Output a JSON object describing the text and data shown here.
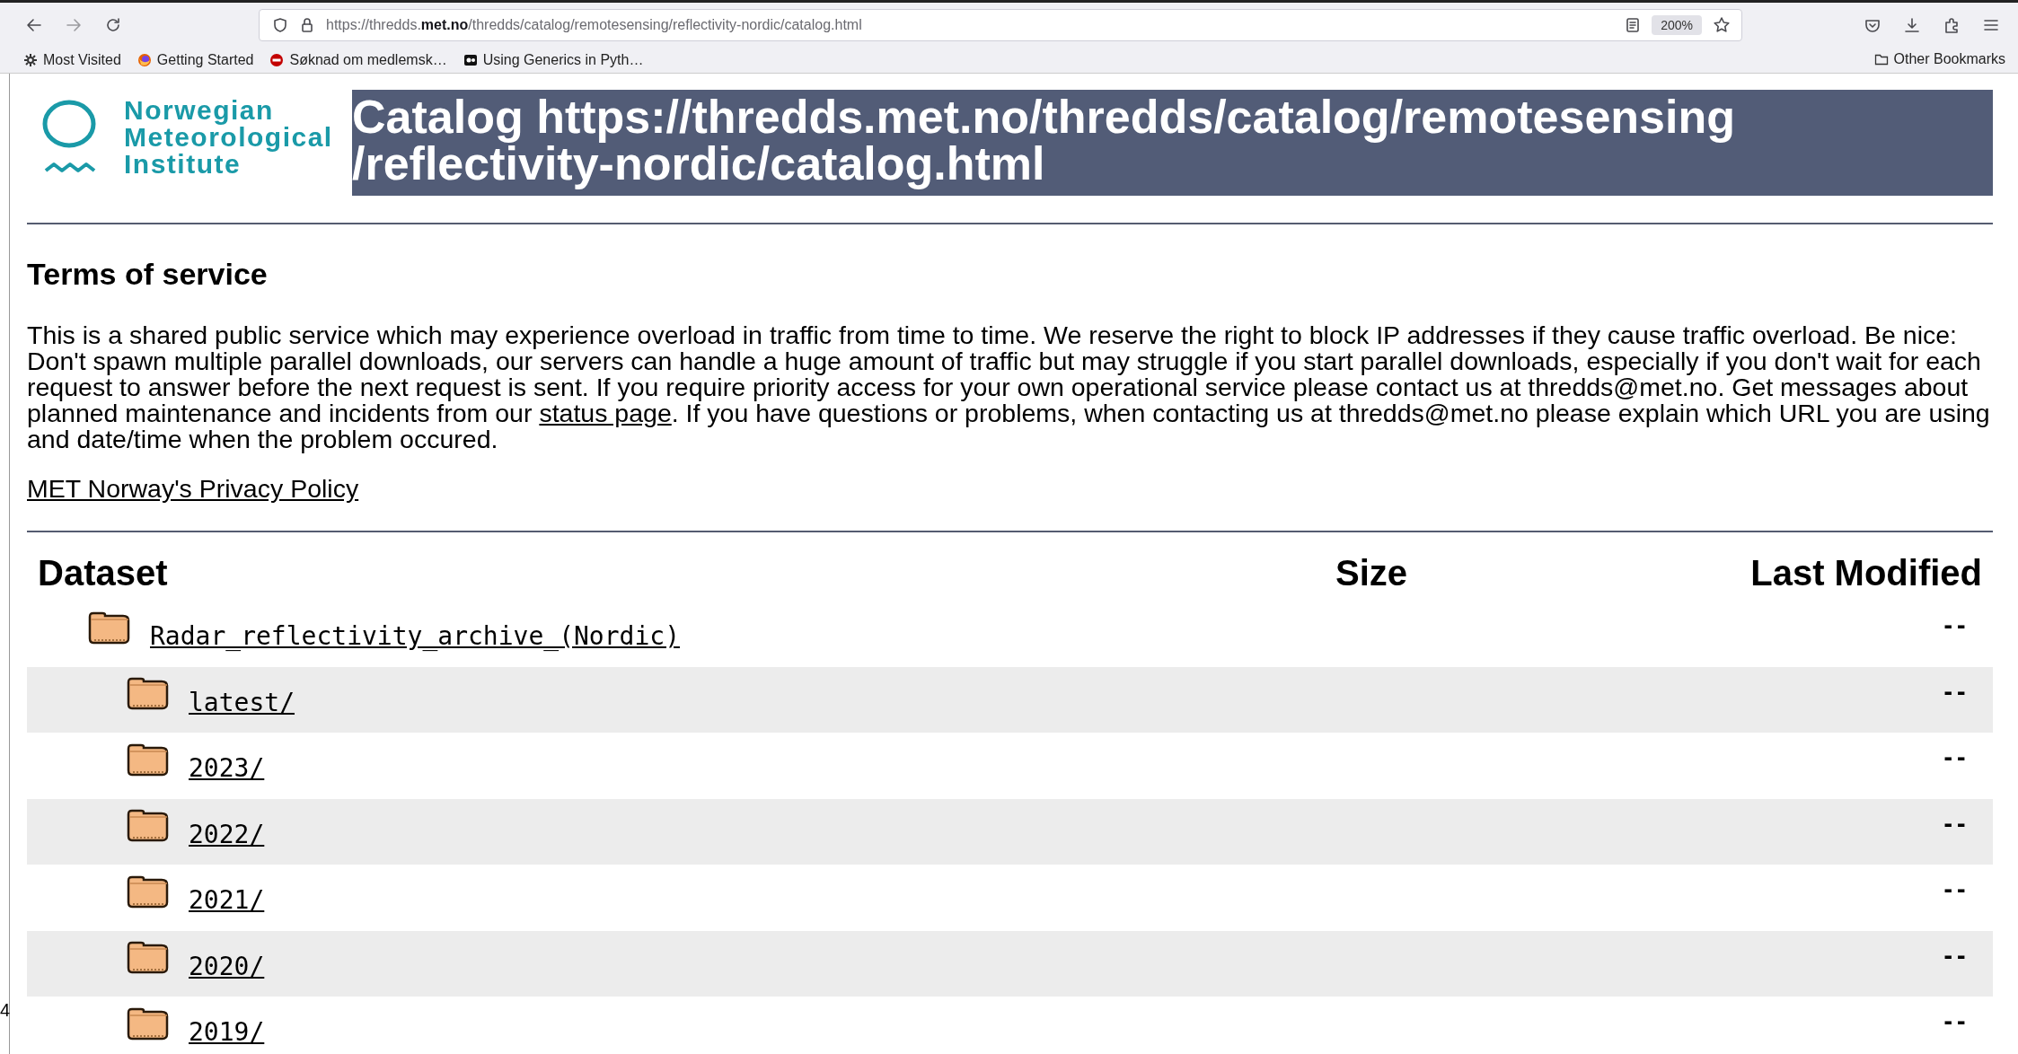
{
  "browser": {
    "url": "https://thredds.**met.no**/thredds/catalog/remotesensing/reflectivity-nordic/catalog.html",
    "zoom": "200%",
    "bookmarks": [
      {
        "kind": "gear",
        "label": "Most Visited"
      },
      {
        "kind": "browser",
        "label": "Getting Started"
      },
      {
        "kind": "red",
        "label": "Søknad om medlemsk…"
      },
      {
        "kind": "dark",
        "label": "Using Generics in Pyth…"
      }
    ],
    "other_bookmarks": "Other Bookmarks"
  },
  "logo": {
    "lines": [
      "Norwegian",
      "Meteorological",
      "Institute"
    ]
  },
  "title": {
    "lines": [
      "Catalog https://thredds.met.no/thredds/catalog/remotesensing",
      "/reflectivity-nordic/catalog.html"
    ]
  },
  "terms": {
    "heading": "Terms of service",
    "text_before": "This is a shared public service which may experience overload in traffic from time to time. We reserve the right to block IP addresses if they cause traffic overload. Be nice: Don't spawn multiple parallel downloads, our servers can handle a huge amount of traffic but may struggle if you start parallel downloads, especially if you don't wait for each request to answer before the next request is sent. If you require priority access for your own operational service please contact us at thredds@met.no. Get messages about planned maintenance and incidents from our",
    "link": "status page",
    "text_after": ". If you have questions or problems, when contacting us at thredds@met.no please explain which URL you are using and date/time when the problem occured.",
    "privacy_link": "MET Norway's Privacy Policy"
  },
  "table": {
    "columns": [
      "Dataset",
      "Size",
      "Last Modified"
    ],
    "rows": [
      {
        "name": "Radar_reflectivity_archive_(Nordic)",
        "last_modified": "--",
        "children": [
          {
            "name": "latest/",
            "last_modified": "--"
          },
          {
            "name": "2023/",
            "last_modified": "--"
          },
          {
            "name": "2022/",
            "last_modified": "--"
          },
          {
            "name": "2021/",
            "last_modified": "--"
          },
          {
            "name": "2020/",
            "last_modified": "--"
          },
          {
            "name": "2019/",
            "last_modified": "--"
          }
        ]
      }
    ]
  },
  "edge_text": "4"
}
